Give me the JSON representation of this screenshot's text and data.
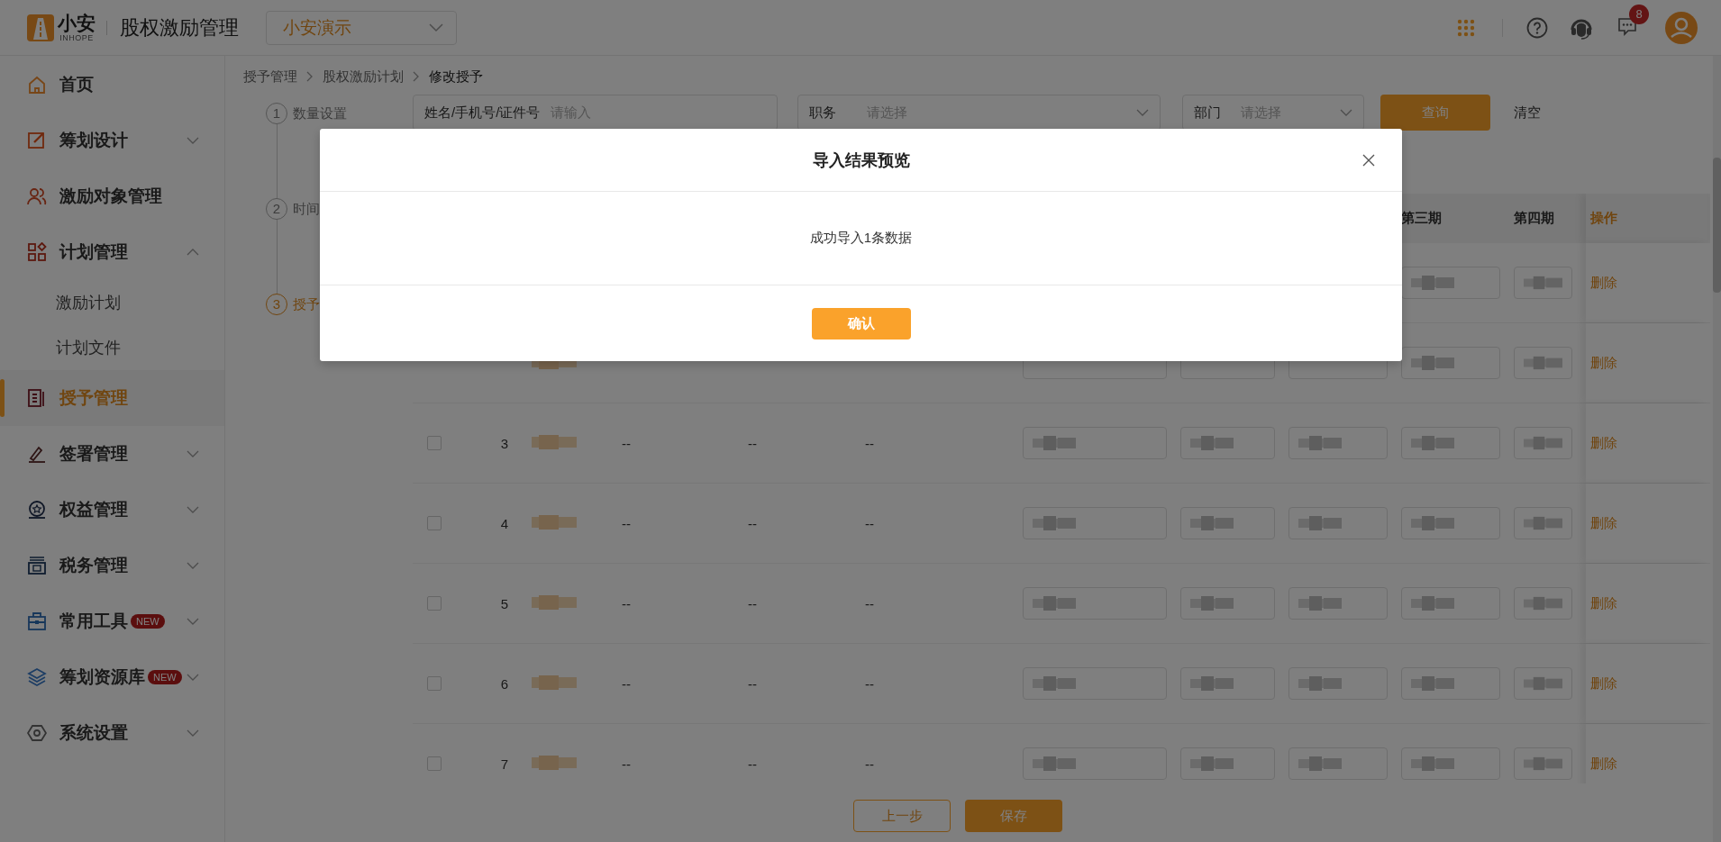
{
  "app": {
    "logo_name": "小安",
    "logo_sub": "INHOPE",
    "title": "股权激励管理",
    "company": "小安演示",
    "notification_count": "8"
  },
  "sidebar": {
    "items": [
      {
        "label": "首页",
        "selected": false
      },
      {
        "label": "筹划设计",
        "selected": false,
        "expanded": false
      },
      {
        "label": "激励对象管理",
        "selected": false
      },
      {
        "label": "计划管理",
        "selected": false,
        "expanded": true,
        "children": [
          {
            "label": "激励计划",
            "selected": false
          },
          {
            "label": "计划文件",
            "selected": false
          }
        ]
      },
      {
        "label": "授予管理",
        "selected": true
      },
      {
        "label": "签署管理",
        "selected": false,
        "expanded": false
      },
      {
        "label": "权益管理",
        "selected": false,
        "expanded": false
      },
      {
        "label": "税务管理",
        "selected": false,
        "expanded": false
      },
      {
        "label": "常用工具",
        "selected": false,
        "expanded": false,
        "badge": "NEW"
      },
      {
        "label": "筹划资源库",
        "selected": false,
        "expanded": false,
        "badge": "NEW"
      },
      {
        "label": "系统设置",
        "selected": false,
        "expanded": false
      }
    ]
  },
  "breadcrumb": [
    "授予管理",
    "股权激励计划",
    "修改授予"
  ],
  "steps": [
    {
      "number": "1",
      "label": "数量设置",
      "selected": false
    },
    {
      "number": "2",
      "label": "时间",
      "selected": false
    },
    {
      "number": "3",
      "label": "授予",
      "selected": true
    }
  ],
  "filters": {
    "search": {
      "label": "姓名/手机号/证件号",
      "placeholder": "请输入"
    },
    "position": {
      "label": "职务",
      "placeholder": "请选择"
    },
    "department": {
      "label": "部门",
      "placeholder": "请选择"
    },
    "query_button": "查询",
    "clear_button": "清空"
  },
  "table": {
    "columns": [
      "第三期",
      "第四期",
      "操作"
    ],
    "rows": [
      {
        "cells": [
          {
            "blurred": true
          },
          {
            "blurred": true
          }
        ],
        "action": "删除"
      },
      {
        "name_blurred": true,
        "cells": [
          {
            "blurred": false
          },
          {
            "blurred": false
          },
          {
            "blurred": false
          },
          {
            "blurred": true
          },
          {
            "blurred": true
          }
        ],
        "action": "删除"
      },
      {
        "checked": false,
        "index": "3",
        "name_blurred": true,
        "col_4": "--",
        "col_5": "--",
        "phone": "--",
        "cells": [
          {
            "blurred": true
          },
          {
            "blurred": true
          },
          {
            "blurred": true
          },
          {
            "blurred": true
          },
          {
            "blurred": true
          }
        ],
        "action": "删除"
      },
      {
        "checked": false,
        "index": "4",
        "name_blurred": true,
        "col_4": "--",
        "col_5": "--",
        "phone": "--",
        "cells": [
          {
            "blurred": true
          },
          {
            "blurred": true
          },
          {
            "blurred": true
          },
          {
            "blurred": true
          },
          {
            "blurred": true
          }
        ],
        "action": "删除"
      },
      {
        "checked": false,
        "index": "5",
        "name_blurred": true,
        "col_4": "--",
        "col_5": "--",
        "phone": "--",
        "cells": [
          {
            "blurred": true
          },
          {
            "blurred": true
          },
          {
            "blurred": true
          },
          {
            "blurred": true
          },
          {
            "blurred": true
          }
        ],
        "action": "删除"
      },
      {
        "checked": false,
        "index": "6",
        "name_blurred": true,
        "col_4": "--",
        "col_5": "--",
        "phone": "--",
        "cells": [
          {
            "blurred": true
          },
          {
            "blurred": true
          },
          {
            "blurred": true
          },
          {
            "blurred": true
          },
          {
            "blurred": true
          }
        ],
        "action": "删除"
      },
      {
        "checked": false,
        "index": "7",
        "name_blurred": true,
        "col_4": "--",
        "col_5": "--",
        "phone": "--",
        "cells": [
          {
            "blurred": true
          },
          {
            "blurred": true
          },
          {
            "blurred": true
          },
          {
            "blurred": true
          },
          {
            "blurred": true
          }
        ],
        "action": "删除"
      }
    ]
  },
  "footer": {
    "back_button": "上一步",
    "save_button": "保存"
  },
  "dialog": {
    "title": "导入结果预览",
    "message": "成功导入1条数据",
    "confirm_button": "确认"
  }
}
